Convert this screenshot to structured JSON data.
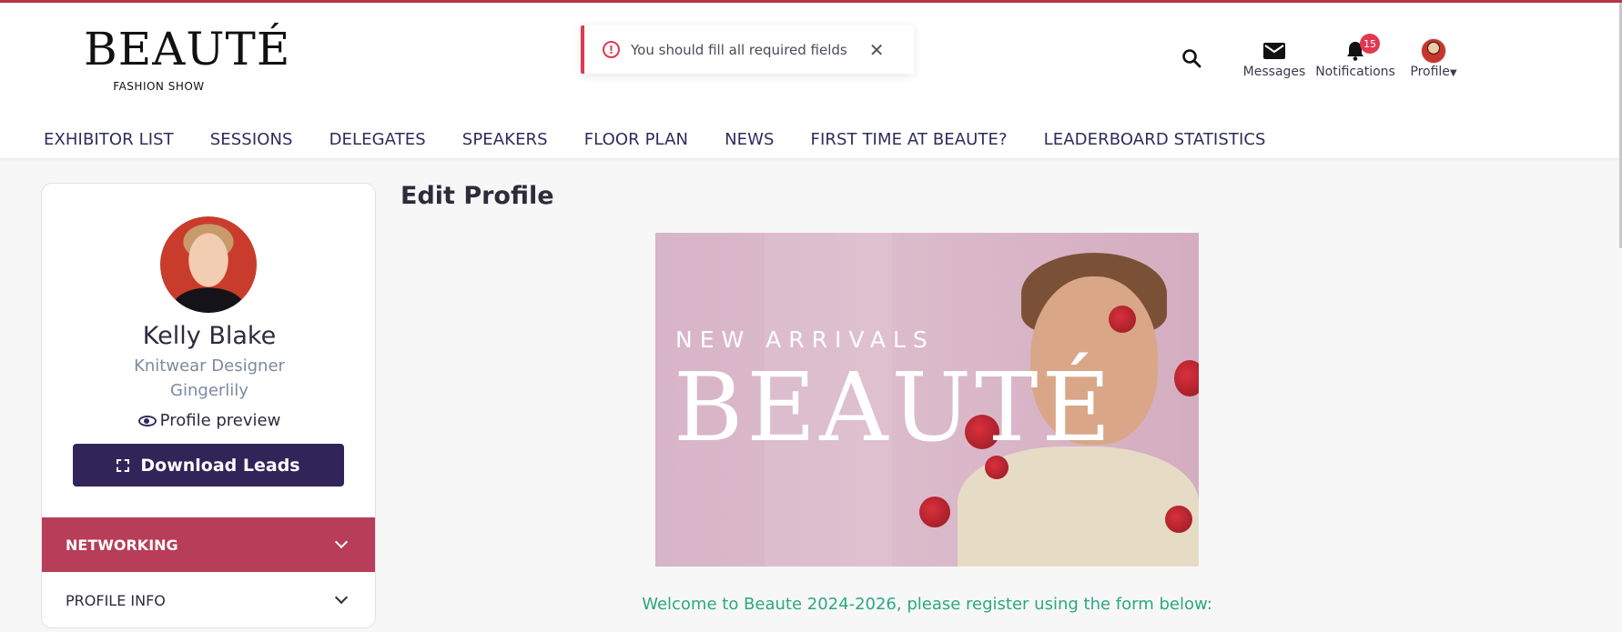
{
  "brand": {
    "name": "BEAUTÉ",
    "subtitle": "FASHION SHOW"
  },
  "toast": {
    "message": "You should fill all required fields",
    "icon": "alert-circle-icon",
    "color": "#e0394f"
  },
  "header_icons": {
    "search": {
      "icon": "search-icon"
    },
    "messages": {
      "label": "Messages",
      "icon": "envelope-icon"
    },
    "notifications": {
      "label": "Notifications",
      "icon": "bell-icon",
      "count": "15"
    },
    "profile": {
      "label": "Profile",
      "icon": "chevron-down-icon"
    }
  },
  "nav": {
    "items": [
      "EXHIBITOR LIST",
      "SESSIONS",
      "DELEGATES",
      "SPEAKERS",
      "FLOOR PLAN",
      "NEWS",
      "FIRST TIME AT BEAUTE?",
      "LEADERBOARD STATISTICS"
    ]
  },
  "sidebar": {
    "name": "Kelly Blake",
    "job_title": "Knitwear Designer",
    "company": "Gingerlily",
    "preview_label": "Profile preview",
    "download_label": "Download Leads",
    "sections": [
      {
        "label": "NETWORKING"
      },
      {
        "label": "PROFILE INFO"
      }
    ]
  },
  "main": {
    "title": "Edit Profile",
    "banner": {
      "kicker": "NEW ARRIVALS",
      "logo": "BEAUTÉ"
    },
    "welcome": "Welcome to Beaute 2024-2026, please register using the form below:"
  },
  "colors": {
    "accent": "#b73d58",
    "primary_button": "#302459",
    "nav_text": "#2f2c5c",
    "welcome_text": "#2ba882",
    "badge": "#e0394f"
  }
}
